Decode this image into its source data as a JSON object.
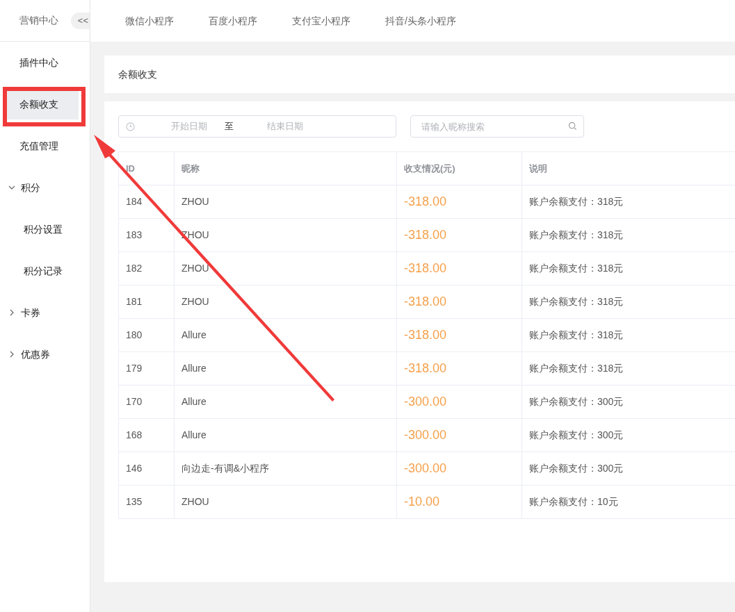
{
  "sidebar": {
    "title": "营销中心",
    "collapse_button": "<<",
    "items": [
      {
        "label": "插件中心",
        "selected": false,
        "highlighted": false
      },
      {
        "label": "余额收支",
        "selected": true,
        "highlighted": true
      },
      {
        "label": "充值管理",
        "selected": false,
        "highlighted": false
      },
      {
        "label": "积分",
        "selected": false,
        "highlighted": false,
        "expanded": true,
        "children": [
          {
            "label": "积分设置",
            "selected": false,
            "highlighted": false
          },
          {
            "label": "积分记录",
            "selected": false,
            "highlighted": false
          }
        ]
      },
      {
        "label": "卡券",
        "selected": false,
        "highlighted": false,
        "expanded": false
      },
      {
        "label": "优惠券",
        "selected": false,
        "highlighted": false,
        "expanded": false
      }
    ]
  },
  "top_tabs": [
    "微信小程序",
    "百度小程序",
    "支付宝小程序",
    "抖音/头条小程序"
  ],
  "page_title": "余额收支",
  "filters": {
    "start_placeholder": "开始日期",
    "separator": "至",
    "end_placeholder": "结束日期",
    "search_placeholder": "请输入昵称搜索"
  },
  "table": {
    "columns": [
      "ID",
      "昵称",
      "收支情况(元)",
      "说明"
    ],
    "rows": [
      [
        "184",
        "ZHOU",
        "-318.00",
        "账户余额支付：318元"
      ],
      [
        "183",
        "ZHOU",
        "-318.00",
        "账户余额支付：318元"
      ],
      [
        "182",
        "ZHOU",
        "-318.00",
        "账户余额支付：318元"
      ],
      [
        "181",
        "ZHOU",
        "-318.00",
        "账户余额支付：318元"
      ],
      [
        "180",
        "Allure",
        "-318.00",
        "账户余额支付：318元"
      ],
      [
        "179",
        "Allure",
        "-318.00",
        "账户余额支付：318元"
      ],
      [
        "170",
        "Allure",
        "-300.00",
        "账户余额支付：300元"
      ],
      [
        "168",
        "Allure",
        "-300.00",
        "账户余额支付：300元"
      ],
      [
        "146",
        "向边走-有调&小程序",
        "-300.00",
        "账户余额支付：300元"
      ],
      [
        "135",
        "ZHOU",
        "-10.00",
        "账户余额支付：10元"
      ]
    ]
  }
}
